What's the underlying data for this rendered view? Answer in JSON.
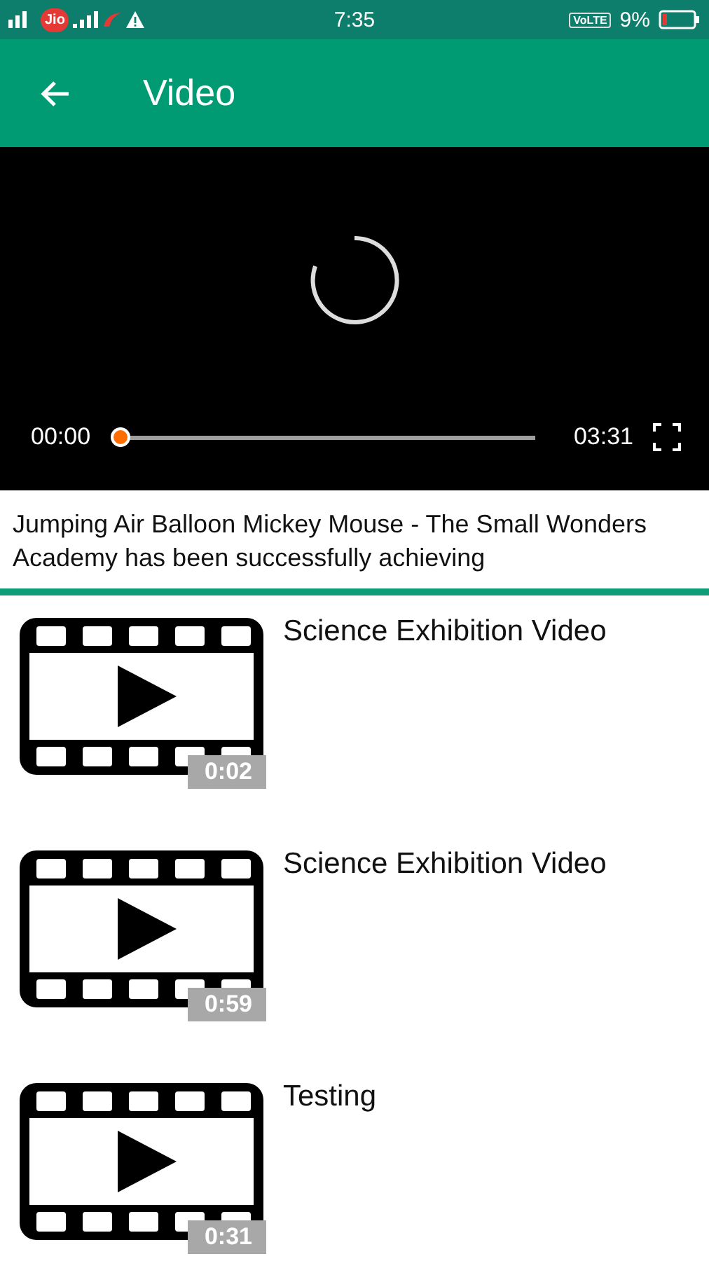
{
  "status_bar": {
    "carrier_badge": "Jio",
    "time": "7:35",
    "network_badge": "VoLTE",
    "battery": "9%"
  },
  "app_bar": {
    "title": "Video"
  },
  "player": {
    "elapsed": "00:00",
    "duration": "03:31",
    "level": 0,
    "loading": true
  },
  "description": "Jumping Air Balloon Mickey Mouse - The Small Wonders Academy has been successfully achieving",
  "videos": [
    {
      "title": "Science Exhibition Video",
      "duration": "0:02"
    },
    {
      "title": "Science Exhibition Video",
      "duration": "0:59"
    },
    {
      "title": "Testing",
      "duration": "0:31"
    }
  ]
}
